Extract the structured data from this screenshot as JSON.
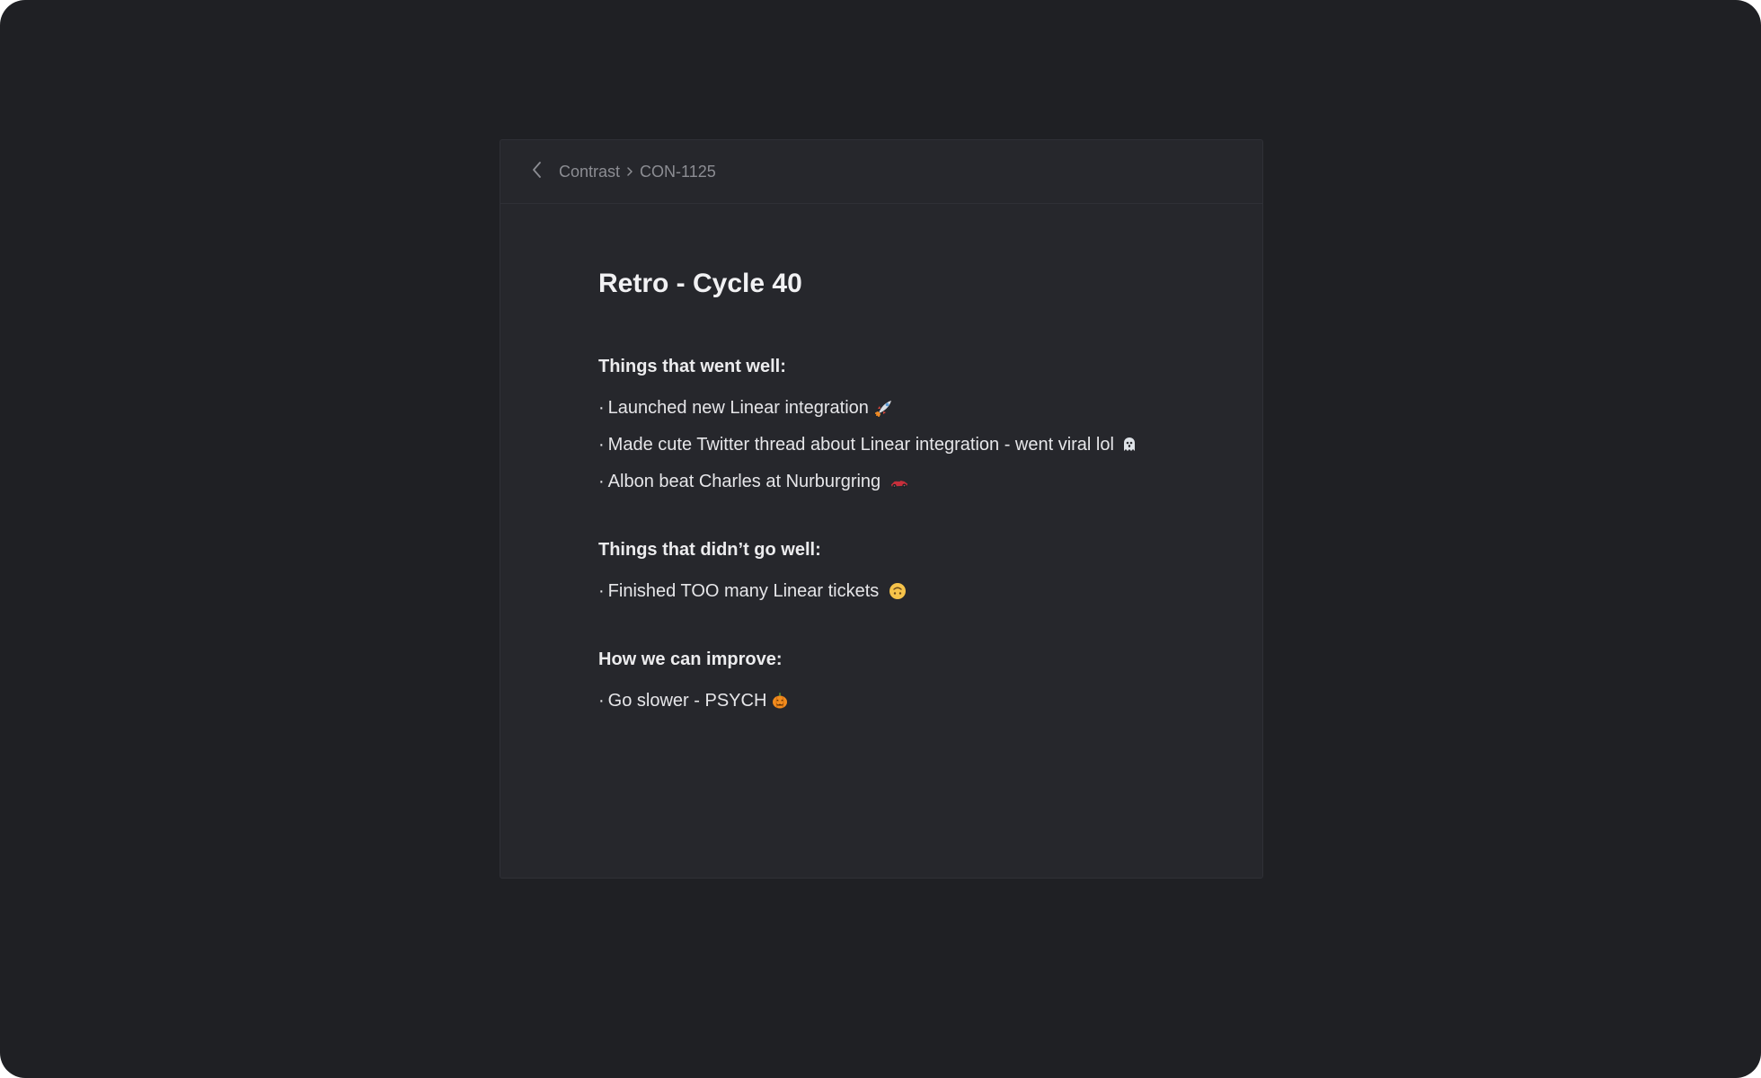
{
  "breadcrumb": {
    "project": "Contrast",
    "issue": "CON-1125"
  },
  "document": {
    "title": "Retro - Cycle 40",
    "sections": [
      {
        "heading": "Things that went well:",
        "items": [
          {
            "text": "Launched new Linear integration",
            "icon": "rocket-icon"
          },
          {
            "text": "Made cute Twitter thread about Linear integration - went viral lol",
            "icon": "ghost-icon"
          },
          {
            "text": "Albon beat Charles at Nurburgring",
            "icon": "race-car-icon"
          }
        ]
      },
      {
        "heading": "Things that didn’t go well:",
        "items": [
          {
            "text": "Finished TOO many Linear tickets",
            "icon": "upside-down-face-icon"
          }
        ]
      },
      {
        "heading": "How we can improve:",
        "items": [
          {
            "text": "Go slower - PSYCH",
            "icon": "pumpkin-icon"
          }
        ]
      }
    ]
  },
  "colors": {
    "background": "#1f2024",
    "panel": "#26272c",
    "border": "#2f3036",
    "text": "#e6e6e9",
    "muted": "#8c8d93"
  }
}
